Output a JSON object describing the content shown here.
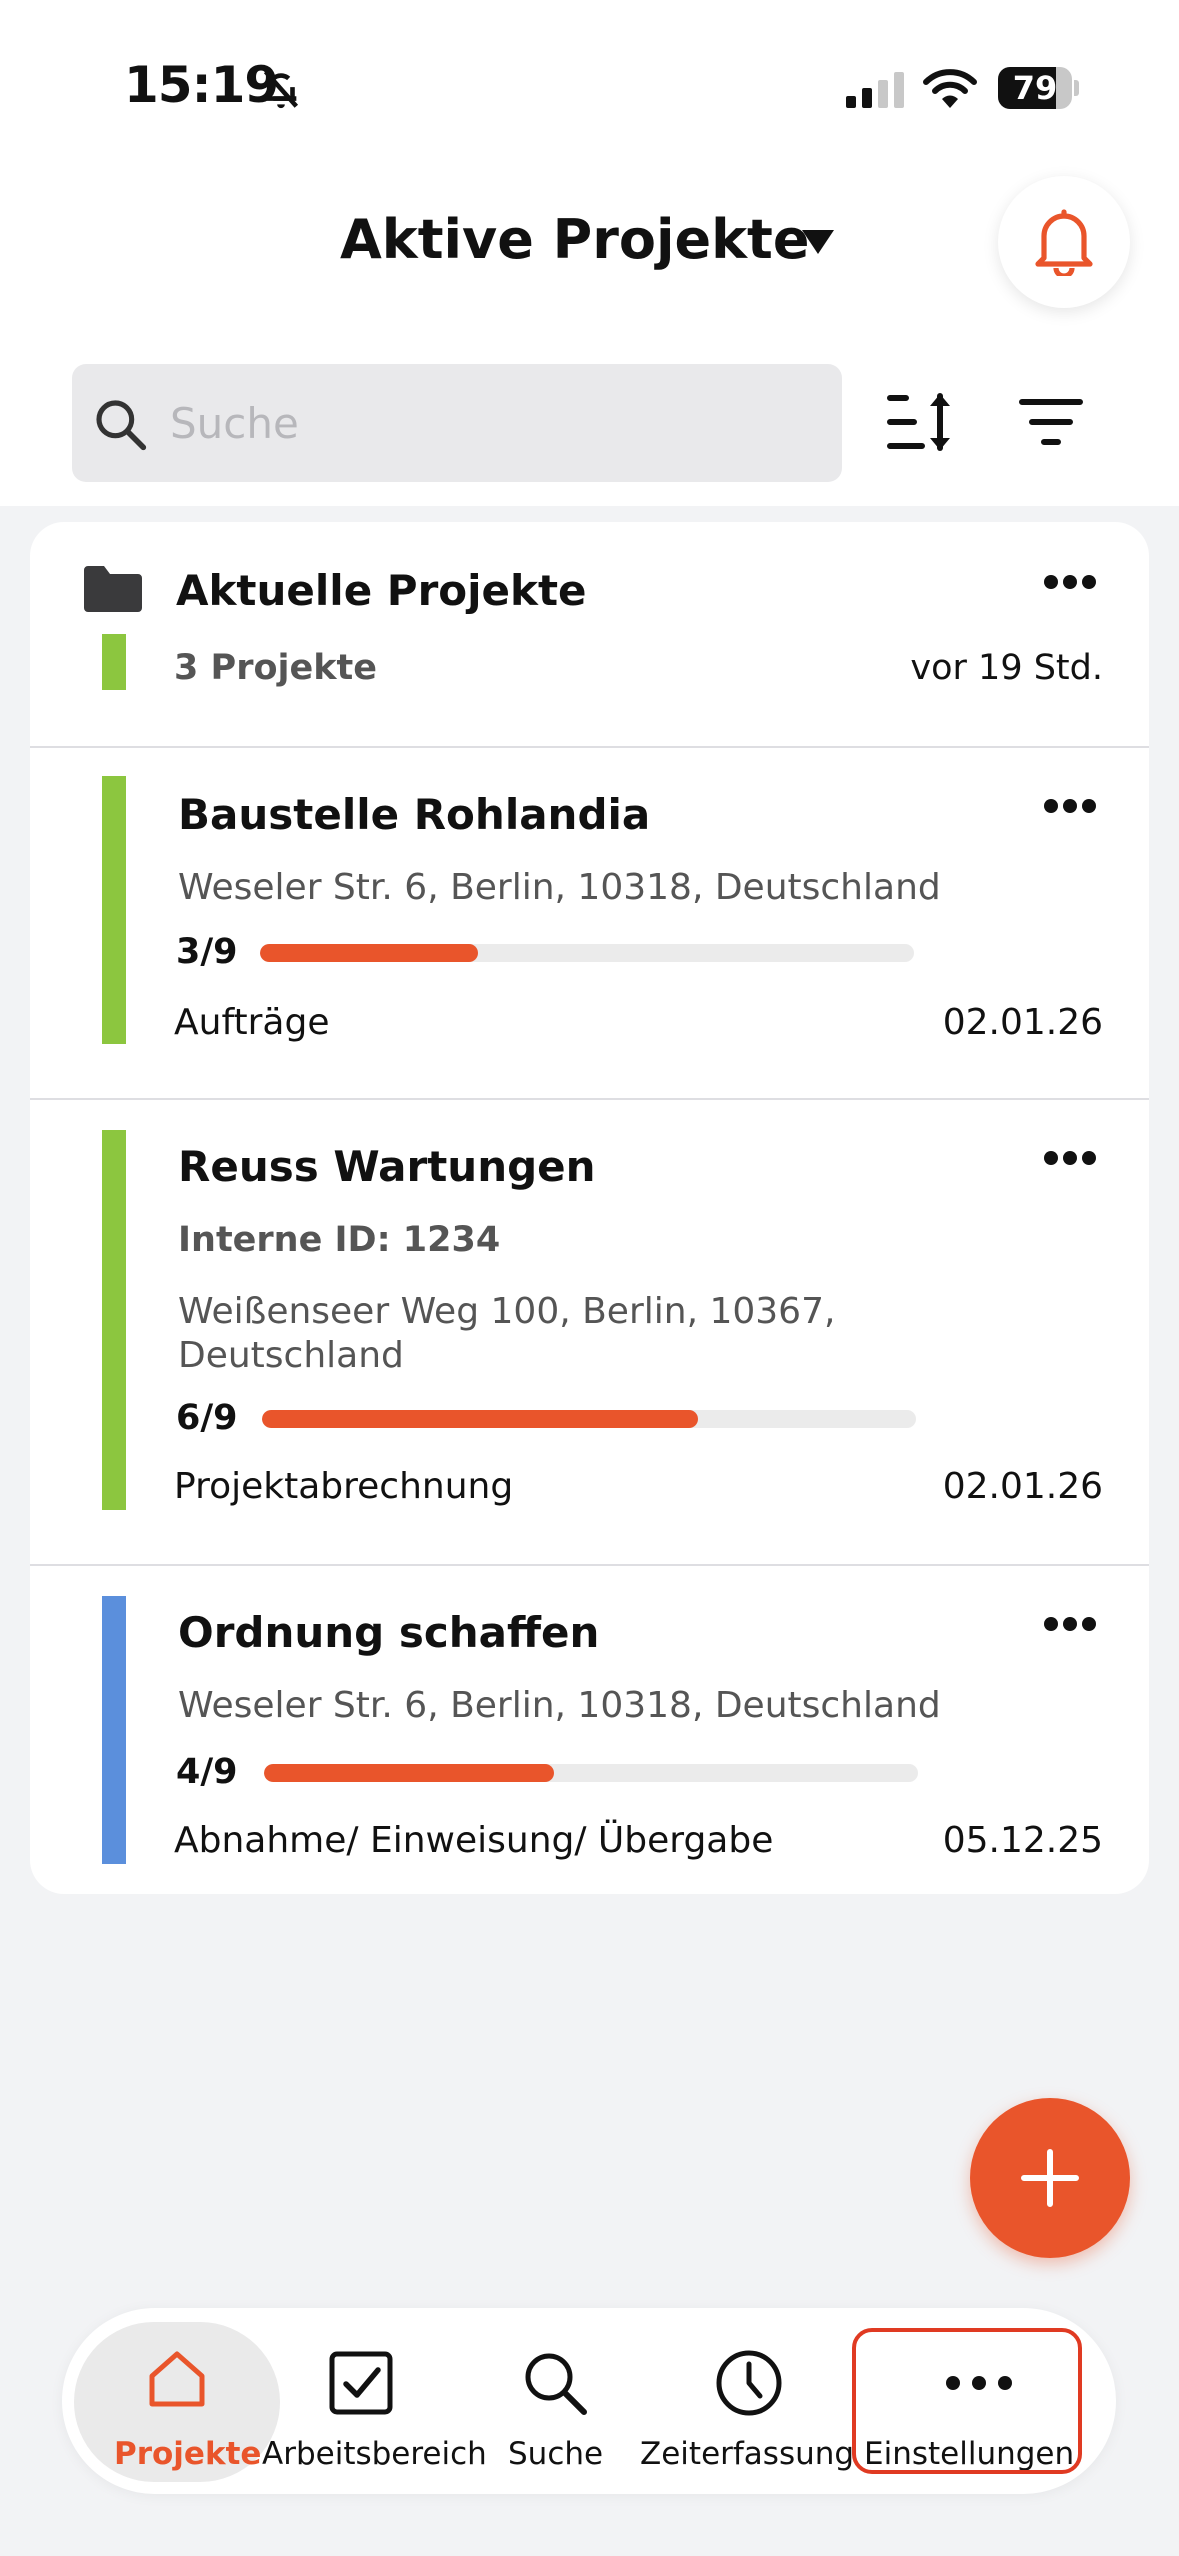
{
  "status_bar": {
    "time": "15:19",
    "battery": "79",
    "battery_level": 0.79,
    "icons": [
      "bell-off-icon",
      "signal-icon",
      "wifi-icon"
    ]
  },
  "header": {
    "title": "Aktive Projekte",
    "icons": [
      "dropdown-icon",
      "bell-icon"
    ]
  },
  "search": {
    "placeholder": "Suche",
    "value": ""
  },
  "toolbar": {
    "icons": [
      "sort-icon",
      "filter-icon"
    ]
  },
  "group": {
    "title": "Aktuelle Projekte",
    "count": "3 Projekte",
    "updated": "vor 19 Std.",
    "color": "#8cc63f"
  },
  "projects": [
    {
      "title": "Baustelle Rohlandia",
      "address": "Weseler Str. 6, Berlin, 10318, Deutschland",
      "ratio": "3/9",
      "progress": 0.333,
      "phase": "Aufträge",
      "date": "02.01.26",
      "color": "#8cc63f"
    },
    {
      "title": "Reuss Wartungen",
      "internal_id": "Interne ID: 1234",
      "address": "Weißenseer Weg 100, Berlin, 10367, Deutschland",
      "ratio": "6/9",
      "progress": 0.667,
      "phase": "Projektabrechnung",
      "date": "02.01.26",
      "color": "#8cc63f"
    },
    {
      "title": "Ordnung schaffen",
      "address": "Weseler Str. 6, Berlin, 10318, Deutschland",
      "ratio": "4/9",
      "progress": 0.444,
      "phase": "Abnahme/ Einweisung/ Übergabe",
      "date": "05.12.25",
      "color": "#5b8fdc"
    }
  ],
  "tabs": [
    {
      "label": "Projekte",
      "icon": "home-icon",
      "active": true
    },
    {
      "label": "Arbeitsbereich",
      "icon": "checkbox-icon"
    },
    {
      "label": "Suche",
      "icon": "search-icon"
    },
    {
      "label": "Zeiterfassung",
      "icon": "clock-icon"
    },
    {
      "label": "Einstellungen",
      "icon": "more-icon"
    }
  ],
  "colors": {
    "accent": "#e9552b",
    "highlight": "#e03a22",
    "background": "#f2f3f5"
  }
}
